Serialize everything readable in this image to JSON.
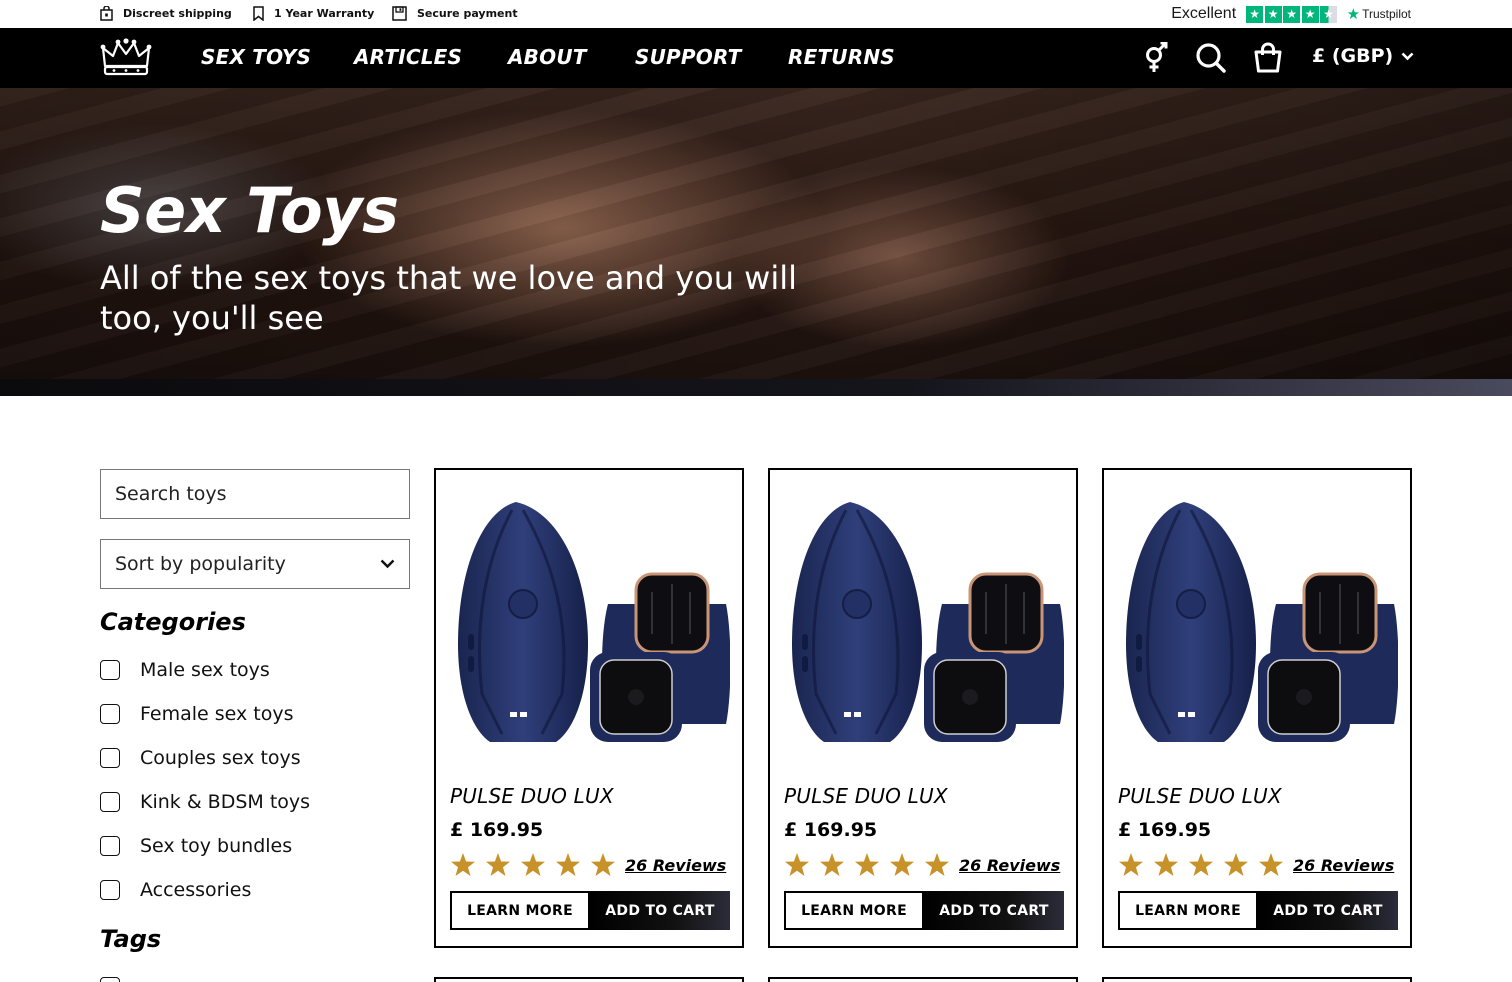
{
  "topbar": {
    "usps": [
      {
        "label": "Discreet shipping",
        "icon": "bag-lock-icon"
      },
      {
        "label": "1 Year Warranty",
        "icon": "bookmark-icon"
      },
      {
        "label": "Secure payment",
        "icon": "floppy-disk-icon"
      }
    ],
    "trustpilot": {
      "rating_text": "Excellent",
      "stars": 4.5,
      "brand": "Trustpilot"
    }
  },
  "nav": {
    "logo": "crown-logo",
    "links": [
      "SEX TOYS",
      "ARTICLES",
      "ABOUT",
      "SUPPORT",
      "RETURNS"
    ],
    "icons": [
      "gender-icon",
      "search-icon",
      "shopping-bag-icon"
    ],
    "currency": "£ (GBP)"
  },
  "hero": {
    "title": "Sex Toys",
    "subtitle": "All of the sex toys that we love and you will too, you'll see"
  },
  "sidebar": {
    "search_placeholder": "Search toys",
    "sort_value": "Sort by popularity",
    "categories_heading": "Categories",
    "categories": [
      "Male sex toys",
      "Female sex toys",
      "Couples sex toys",
      "Kink & BDSM toys",
      "Sex toy bundles",
      "Accessories"
    ],
    "tags_heading": "Tags"
  },
  "products": [
    {
      "name": "PULSE DUO LUX",
      "price": "£ 169.95",
      "rating": 5,
      "reviews": "26 Reviews",
      "learn_more": "LEARN MORE",
      "add_to_cart": "ADD TO CART"
    },
    {
      "name": "PULSE DUO LUX",
      "price": "£ 169.95",
      "rating": 5,
      "reviews": "26 Reviews",
      "learn_more": "LEARN MORE",
      "add_to_cart": "ADD TO CART"
    },
    {
      "name": "PULSE DUO LUX",
      "price": "£ 169.95",
      "rating": 5,
      "reviews": "26 Reviews",
      "learn_more": "LEARN MORE",
      "add_to_cart": "ADD TO CART"
    }
  ],
  "colors": {
    "accent_star": "#c8922a",
    "nav_bg": "#000000",
    "trustpilot_green": "#00b67a",
    "product_navy": "#1f2d5a"
  }
}
